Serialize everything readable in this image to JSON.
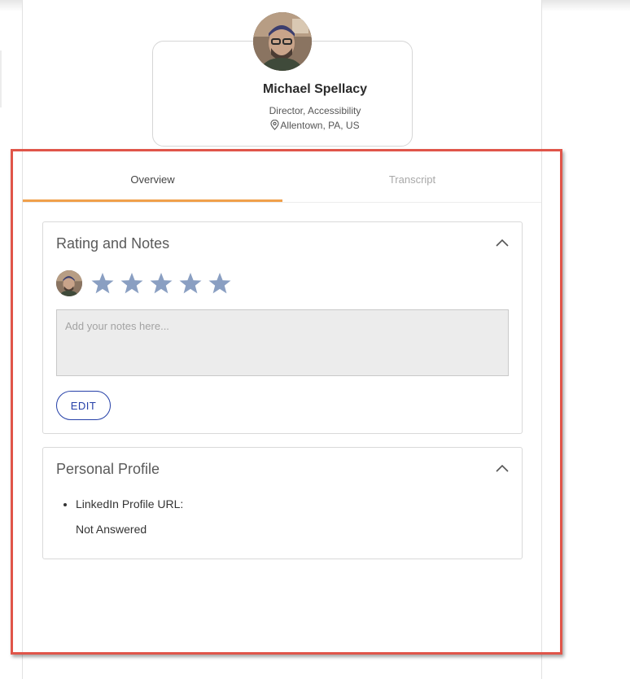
{
  "profile": {
    "name": "Michael Spellacy",
    "role": "Director, Accessibility",
    "location": "Allentown, PA, US"
  },
  "tabs": [
    {
      "label": "Overview",
      "active": true
    },
    {
      "label": "Transcript",
      "active": false
    }
  ],
  "rating_notes": {
    "title": "Rating and Notes",
    "rating": 0,
    "max_stars": 5,
    "star_color": "#8a9fc2",
    "notes_placeholder": "Add your notes here...",
    "notes_value": "",
    "edit_label": "EDIT"
  },
  "personal_profile": {
    "title": "Personal Profile",
    "question": "LinkedIn Profile URL:",
    "answer": "Not Answered"
  },
  "colors": {
    "tab_active_underline": "#f0a04b",
    "edit_button": "#2540a8",
    "highlight_box": "#e05549"
  },
  "icons": {
    "location": "map-pin-icon",
    "collapse": "chevron-up-icon",
    "star": "star-icon"
  }
}
